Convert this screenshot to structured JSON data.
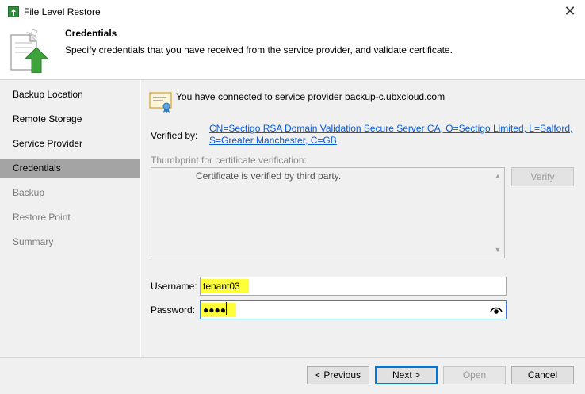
{
  "window": {
    "title": "File Level Restore",
    "close_glyph": "✕"
  },
  "header": {
    "title": "Credentials",
    "description": "Specify credentials that you have received from the service provider, and validate certificate."
  },
  "steps": [
    {
      "label": "Backup Location",
      "state": "done"
    },
    {
      "label": "Remote Storage",
      "state": "done"
    },
    {
      "label": "Service Provider",
      "state": "done"
    },
    {
      "label": "Credentials",
      "state": "active"
    },
    {
      "label": "Backup",
      "state": "disabled"
    },
    {
      "label": "Restore Point",
      "state": "disabled"
    },
    {
      "label": "Summary",
      "state": "disabled"
    }
  ],
  "main": {
    "connected_text": "You have connected to service provider backup-c.ubxcloud.com",
    "verified_label": "Verified by:",
    "verified_by_line1": "CN=Sectigo RSA Domain Validation Secure Server CA, O=Sectigo Limited, L=Salford,",
    "verified_by_line2": "S=Greater Manchester, C=GB",
    "thumbprint_label": "Thumbprint for certificate verification:",
    "thumbprint_text": "Certificate is verified by third party.",
    "verify_button": "Verify",
    "username_label": "Username:",
    "username_value": "tenant03",
    "password_label": "Password:",
    "password_value": "●●●●"
  },
  "footer": {
    "previous": "< Previous",
    "next": "Next >",
    "open": "Open",
    "cancel": "Cancel"
  },
  "colors": {
    "highlight": "#ffff3a",
    "link": "#0a5bd3",
    "active_step": "#a4a4a4",
    "panel_bg": "#f0f0f0"
  }
}
